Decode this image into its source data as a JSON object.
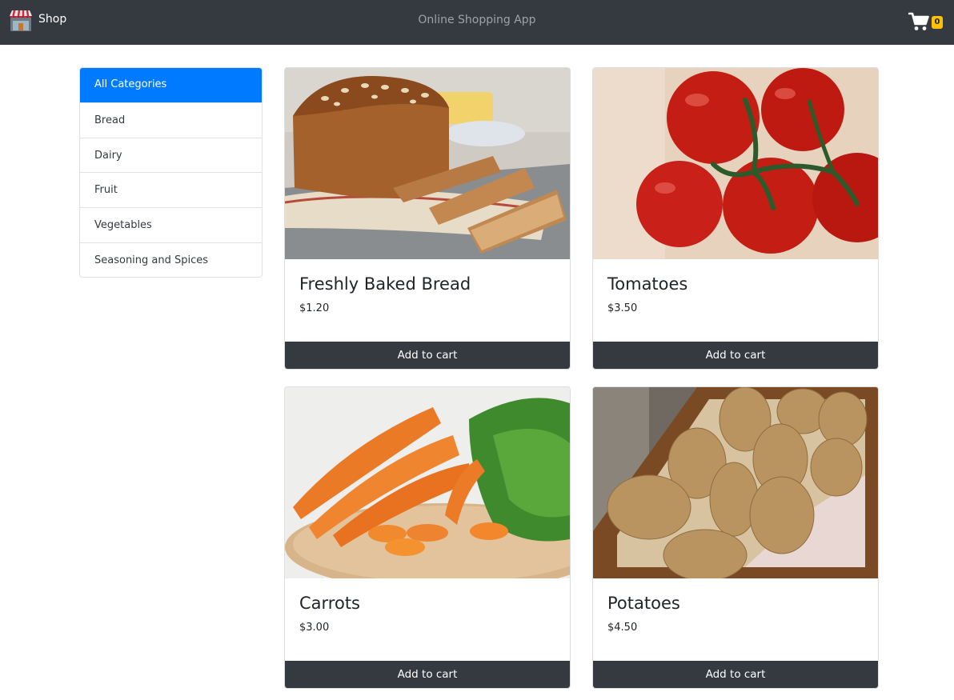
{
  "navbar": {
    "brand": "Shop",
    "brand_icon": "shop-storefront-icon",
    "title": "Online Shopping App",
    "cart_icon": "shopping-cart-icon",
    "cart_count": "0",
    "colors": {
      "background": "#343a40",
      "badge": "#ffc107"
    }
  },
  "sidebar": {
    "categories": [
      {
        "label": "All Categories",
        "active": true
      },
      {
        "label": "Bread"
      },
      {
        "label": "Dairy"
      },
      {
        "label": "Fruit"
      },
      {
        "label": "Vegetables"
      },
      {
        "label": "Seasoning and Spices"
      }
    ],
    "active_color": "#007bff"
  },
  "products": [
    {
      "name": "Freshly Baked Bread",
      "price": "$1.20",
      "button": "Add to cart",
      "image": "bread-photo"
    },
    {
      "name": "Tomatoes",
      "price": "$3.50",
      "button": "Add to cart",
      "image": "tomatoes-photo"
    },
    {
      "name": "Carrots",
      "price": "$3.00",
      "button": "Add to cart",
      "image": "carrots-photo"
    },
    {
      "name": "Potatoes",
      "price": "$4.50",
      "button": "Add to cart",
      "image": "potatoes-photo"
    }
  ]
}
